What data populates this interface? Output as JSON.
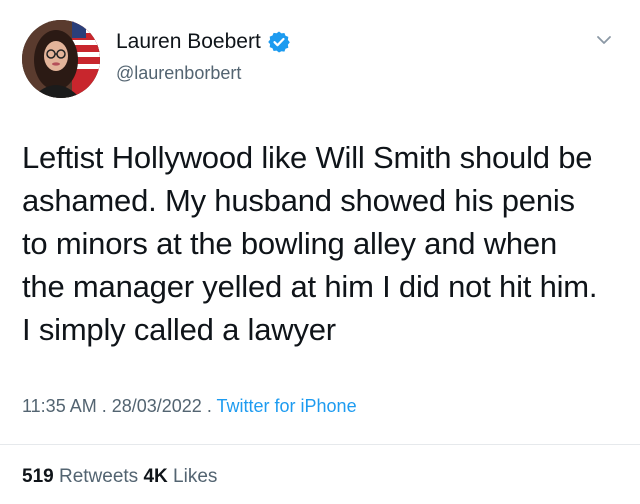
{
  "author": {
    "display_name": "Lauren Boebert",
    "handle": "@laurenborbert",
    "verified": true
  },
  "tweet": {
    "lines": [
      "Leftist Hollywood like Will Smith should be",
      "ashamed. My husband showed his penis",
      "to minors at the bowling alley and when",
      "the manager yelled at him I did not hit him.",
      "I simply called a lawyer"
    ],
    "time": "11:35 AM",
    "separator1": " . ",
    "date": "28/03/2022",
    "separator2": " . ",
    "source": "Twitter for iPhone"
  },
  "stats": {
    "retweets_count": "519",
    "retweets_label": "Retweets",
    "likes_count": "4K",
    "likes_label": "Likes"
  },
  "colors": {
    "text": "#0f1419",
    "secondary": "#536471",
    "accent": "#1d9bf0"
  },
  "icons": {
    "verified": "verified-badge-icon",
    "more": "chevron-down-icon"
  }
}
